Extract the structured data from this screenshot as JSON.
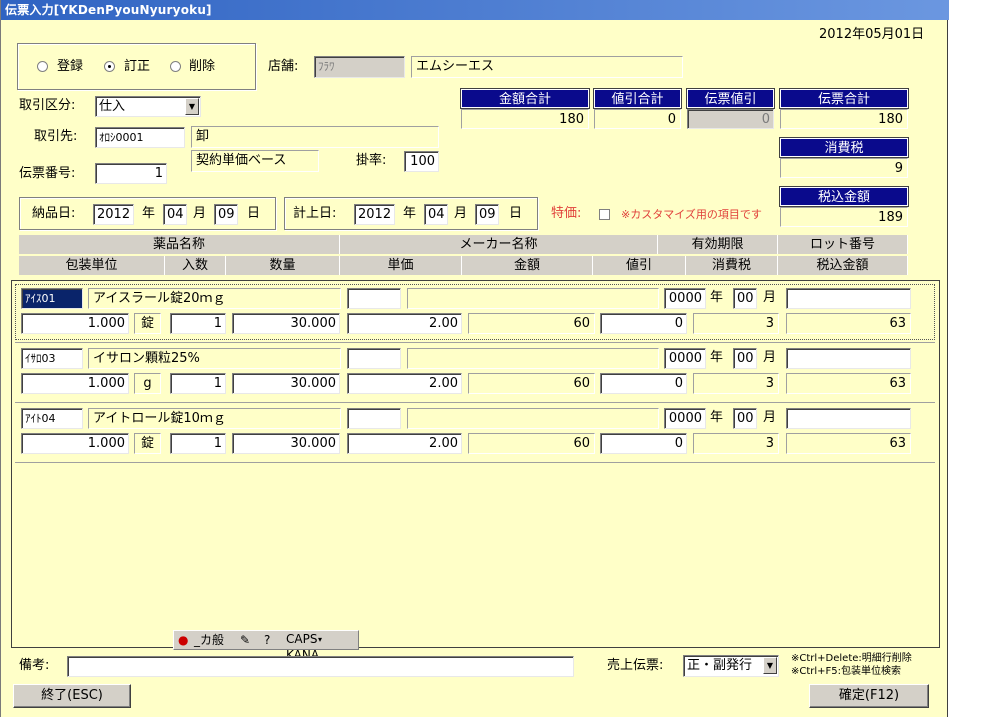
{
  "window": {
    "title": "伝票入力[YKDenPyouNyuryoku]"
  },
  "header": {
    "date": "2012年05月01日"
  },
  "mode": {
    "options": [
      "登録",
      "訂正",
      "削除"
    ],
    "selected": 1
  },
  "store": {
    "label": "店舗:",
    "code": "ﾌﾗﾜ",
    "name": "エムシーエス"
  },
  "trade_type": {
    "label": "取引区分:",
    "value": "仕入"
  },
  "partner": {
    "label": "取引先:",
    "code": "ｵﾛｼ0001",
    "name": "卸",
    "price_base": "契約単価ベース",
    "rate_label": "掛率:",
    "rate": "100"
  },
  "slip_no": {
    "label": "伝票番号:",
    "value": "1"
  },
  "delivery_date": {
    "label": "納品日:",
    "year": "2012",
    "month": "04",
    "day": "09",
    "y": "年",
    "m": "月",
    "d": "日"
  },
  "posting_date": {
    "label": "計上日:",
    "year": "2012",
    "month": "04",
    "day": "09",
    "y": "年",
    "m": "月",
    "d": "日"
  },
  "special_price": {
    "label": "特価:",
    "note": "※カスタマイズ用の項目です"
  },
  "totals": {
    "amount_label": "金額合計",
    "amount": "180",
    "discount_label": "値引合計",
    "discount": "0",
    "slip_discount_label": "伝票値引",
    "slip_discount": "0",
    "slip_total_label": "伝票合計",
    "slip_total": "180",
    "tax_label": "消費税",
    "tax": "9",
    "taxed_label": "税込金額",
    "taxed": "189"
  },
  "columns": {
    "row1": [
      "薬品名称",
      "メーカー名称",
      "有効期限",
      "ロット番号"
    ],
    "row2": [
      "包装単位",
      "入数",
      "数量",
      "単価",
      "金額",
      "値引",
      "消費税",
      "税込金額"
    ]
  },
  "items": [
    {
      "code": "ｱｲｽ01",
      "name": "アイスラール錠20ｍｇ",
      "maker_code": "",
      "maker": "",
      "exp_year": "0000",
      "exp_month": "00",
      "y": "年",
      "m": "月",
      "lot": "",
      "pack": "1.000",
      "unit": "錠",
      "per": "1",
      "qty": "30.000",
      "price": "2.00",
      "amount": "60",
      "discount": "0",
      "tax": "3",
      "taxed": "63"
    },
    {
      "code": "ｲｻﾛ03",
      "name": "イサロン顆粒25%",
      "maker_code": "",
      "maker": "",
      "exp_year": "0000",
      "exp_month": "00",
      "y": "年",
      "m": "月",
      "lot": "",
      "pack": "1.000",
      "unit": "g",
      "per": "1",
      "qty": "30.000",
      "price": "2.00",
      "amount": "60",
      "discount": "0",
      "tax": "3",
      "taxed": "63"
    },
    {
      "code": "ｱｲﾄ04",
      "name": "アイトロール錠10ｍｇ",
      "maker_code": "",
      "maker": "",
      "exp_year": "0000",
      "exp_month": "00",
      "y": "年",
      "m": "月",
      "lot": "",
      "pack": "1.000",
      "unit": "錠",
      "per": "1",
      "qty": "30.000",
      "price": "2.00",
      "amount": "60",
      "discount": "0",
      "tax": "3",
      "taxed": "63"
    }
  ],
  "footer": {
    "remarks_label": "備考:",
    "remarks": "",
    "sales_slip_label": "売上伝票:",
    "sales_slip": "正・副発行",
    "hint1": "※Ctrl+Delete:明細行削除",
    "hint2": "※Ctrl+F5:包装単位検索",
    "exit_label": "終了(ESC)",
    "confirm_label": "確定(F12)"
  },
  "ime_tray": {
    "mode": "_カ般",
    "caps": "CAPS",
    "kana": "KANA"
  }
}
